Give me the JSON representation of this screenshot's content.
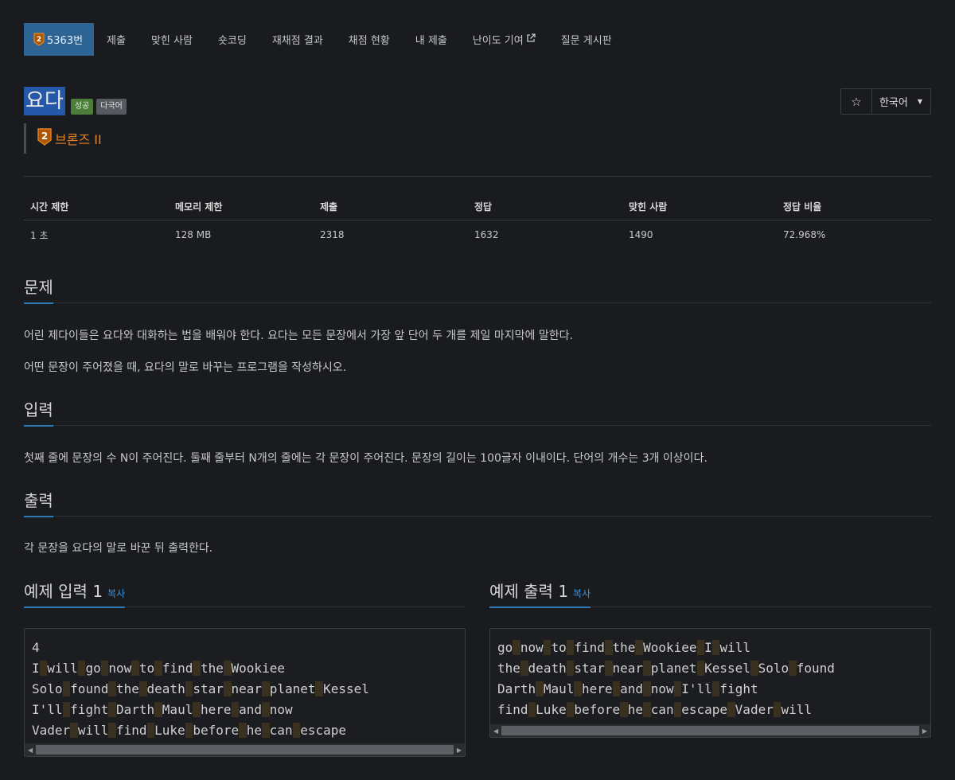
{
  "nav": {
    "tier_badge": "2",
    "items": [
      "5363번",
      "제출",
      "맞힌 사람",
      "숏코딩",
      "재채점 결과",
      "채점 현황",
      "내 제출",
      "난이도 기여",
      "질문 게시판"
    ]
  },
  "problem": {
    "title": "요다",
    "label_success": "성공",
    "label_multi": "다국어",
    "tier": "브론즈 II",
    "tier_level": "2",
    "star_icon": "☆",
    "language": "한국어"
  },
  "stats": {
    "headers": [
      "시간 제한",
      "메모리 제한",
      "제출",
      "정답",
      "맞힌 사람",
      "정답 비율"
    ],
    "values": [
      "1 초",
      "128 MB",
      "2318",
      "1632",
      "1490",
      "72.968%"
    ]
  },
  "sections": {
    "problem": {
      "title": "문제",
      "paragraphs": [
        "어린 제다이들은 요다와 대화하는 법을 배워야 한다. 요다는 모든 문장에서 가장 앞 단어 두 개를 제일 마지막에 말한다.",
        "어떤 문장이 주어졌을 때, 요다의 말로 바꾸는 프로그램을 작성하시오."
      ]
    },
    "input": {
      "title": "입력",
      "text": "첫째 줄에 문장의 수 N이 주어진다. 둘째 줄부터 N개의 줄에는 각 문장이 주어진다. 문장의 길이는 100글자 이내이다. 단어의 개수는 3개 이상이다."
    },
    "output": {
      "title": "출력",
      "text": "각 문장을 요다의 말로 바꾼 뒤 출력한다."
    }
  },
  "samples": {
    "input_title": "예제 입력 1",
    "output_title": "예제 출력 1",
    "copy_label": "복사",
    "input_lines": [
      "4",
      "I will go now to find the Wookiee",
      "Solo found the death star near planet Kessel",
      "I'll fight Darth Maul here and now",
      "Vader will find Luke before he can escape"
    ],
    "output_lines": [
      "go now to find the Wookiee I will",
      "the death star near planet Kessel Solo found",
      "Darth Maul here and now I'll fight",
      "find Luke before he can escape Vader will"
    ]
  },
  "colors": {
    "background": "#1a1b1e",
    "nav_active": "#2d6493",
    "accent_blue": "#2f79b5",
    "tier_orange": "#e0842b",
    "success_green": "#4c7d3b"
  }
}
